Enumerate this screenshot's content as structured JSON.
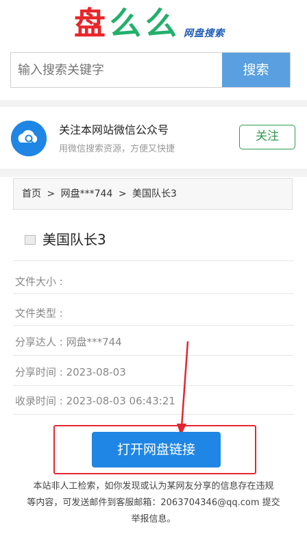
{
  "logo": {
    "char1": "盘",
    "char2": "么",
    "char3": "么",
    "subtitle": "网盘搜索"
  },
  "search": {
    "placeholder": "输入搜索关键字",
    "button_label": "搜索"
  },
  "follow": {
    "title": "关注本网站微信公众号",
    "desc": "用微信搜索资源，方便又快捷",
    "button_label": "关注"
  },
  "breadcrumb": {
    "home": "首页",
    "sep": ">",
    "user": "网盘***744",
    "current": "美国队长3"
  },
  "file": {
    "title": "美国队长3",
    "rows": [
      {
        "label": "文件大小 :",
        "value": ""
      },
      {
        "label": "文件类型 :",
        "value": ""
      },
      {
        "label": "分享达人 :",
        "value": " 网盘***744"
      },
      {
        "label": "分享时间 :",
        "value": " 2023-08-03"
      },
      {
        "label": "收录时间 :",
        "value": " 2023-08-03 06:43:21"
      }
    ]
  },
  "open_button_label": "打开网盘链接",
  "notice": {
    "line1": "本站非人工检索，如你发现或认为某网友分享的信息存在违规",
    "line2": "等内容，可发送邮件到客服邮箱：2063704346@qq.com 提交",
    "line3": "举报信息。"
  },
  "colors": {
    "logo_red": "#e8262a",
    "logo_green": "#22b06b",
    "primary_blue": "#1f86e5",
    "follow_green": "#2e9a4a",
    "highlight_red": "#e3262f"
  }
}
